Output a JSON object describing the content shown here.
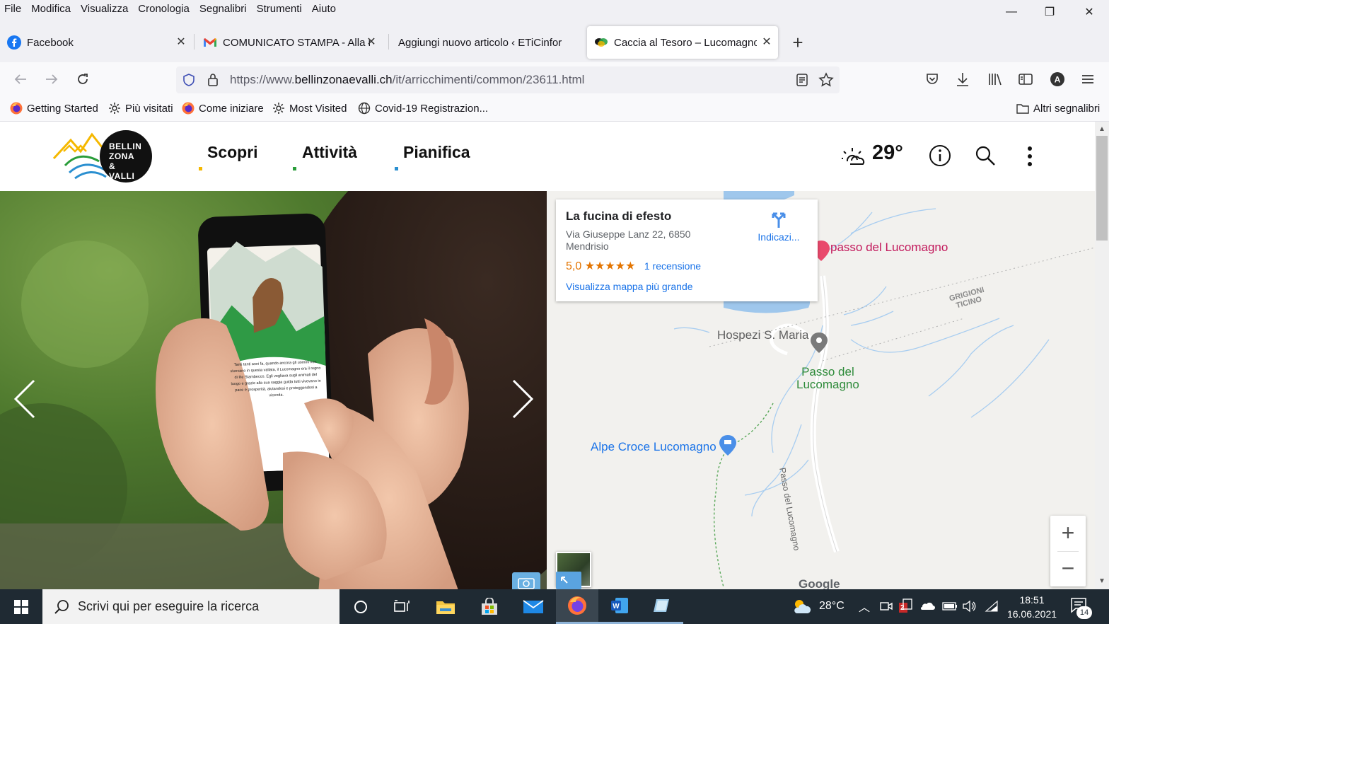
{
  "menubar": {
    "items": [
      "File",
      "Modifica",
      "Visualizza",
      "Cronologia",
      "Segnalibri",
      "Strumenti",
      "Aiuto"
    ]
  },
  "window_controls": {
    "minimize": "—",
    "restore": "❐",
    "close": "✕"
  },
  "tabs": [
    {
      "title": "Facebook",
      "icon": "facebook-icon",
      "active": false
    },
    {
      "title": "COMUNICATO STAMPA - Alla ri",
      "icon": "gmail-icon",
      "active": false
    },
    {
      "title": "Aggiungi nuovo articolo ‹ ETiCinfor",
      "icon": "none",
      "active": false
    },
    {
      "title": "Caccia al Tesoro – Lucomagno |",
      "icon": "site-icon",
      "active": true
    }
  ],
  "new_tab_label": "+",
  "address": {
    "prefix": "https://www.",
    "domain": "bellinzonaevalli.ch",
    "path": "/it/arricchimenti/common/23611.html"
  },
  "bookmarks": [
    {
      "label": "Getting Started",
      "icon": "firefox-icon"
    },
    {
      "label": "Più visitati",
      "icon": "gear-icon"
    },
    {
      "label": "Come iniziare",
      "icon": "firefox-icon"
    },
    {
      "label": "Most Visited",
      "icon": "gear-icon"
    },
    {
      "label": "Covid-19 Registrazion...",
      "icon": "globe-icon"
    }
  ],
  "other_bookmarks": "Altri segnalibri",
  "site": {
    "logo_lines": [
      "BELLIN",
      "ZONA",
      "& VALLI"
    ],
    "nav": [
      {
        "label": "Scopri",
        "dot_color": "#f5b800"
      },
      {
        "label": "Attività",
        "dot_color": "#2a9d3a"
      },
      {
        "label": "Pianifica",
        "dot_color": "#2a8fd0"
      }
    ],
    "weather_temp": "29°",
    "phone_text": "Tanti tanti anni fa, quando ancora gli uomini non vivevano in questa vallata, il Lucomagno era il regno di Re Stambecco. Egli vegliava sugli animali del luogo e grazie alla sua saggia guida tutti vivevano in pace e prosperità, aiutandosi e proteggendosi a vicenda."
  },
  "map": {
    "card": {
      "title": "La fucina di efesto",
      "address_line1": "Via Giuseppe Lanz 22, 6850",
      "address_line2": "Mendrisio",
      "rating": "5,0",
      "stars": "★★★★★",
      "reviews": "1 recensione",
      "larger_map": "Visualizza mappa più grande",
      "directions": "Indicazi..."
    },
    "labels": {
      "passo_pin": "passo del Lucomagno",
      "hospezi": "Hospezi S. Maria",
      "passo_area_1": "Passo del",
      "passo_area_2": "Lucomagno",
      "alpe": "Alpe Croce Lucomagno",
      "border_1": "GRIGIONI",
      "border_2": "TICINO",
      "road": "Passo del Lucomagno",
      "google": "Google"
    },
    "zoom_in": "+",
    "zoom_out": "−"
  },
  "taskbar": {
    "search_placeholder": "Scrivi qui per eseguire la ricerca",
    "weather": "28°C",
    "time": "18:51",
    "date": "16.06.2021",
    "notifications": "14",
    "mail_badge": "2"
  }
}
